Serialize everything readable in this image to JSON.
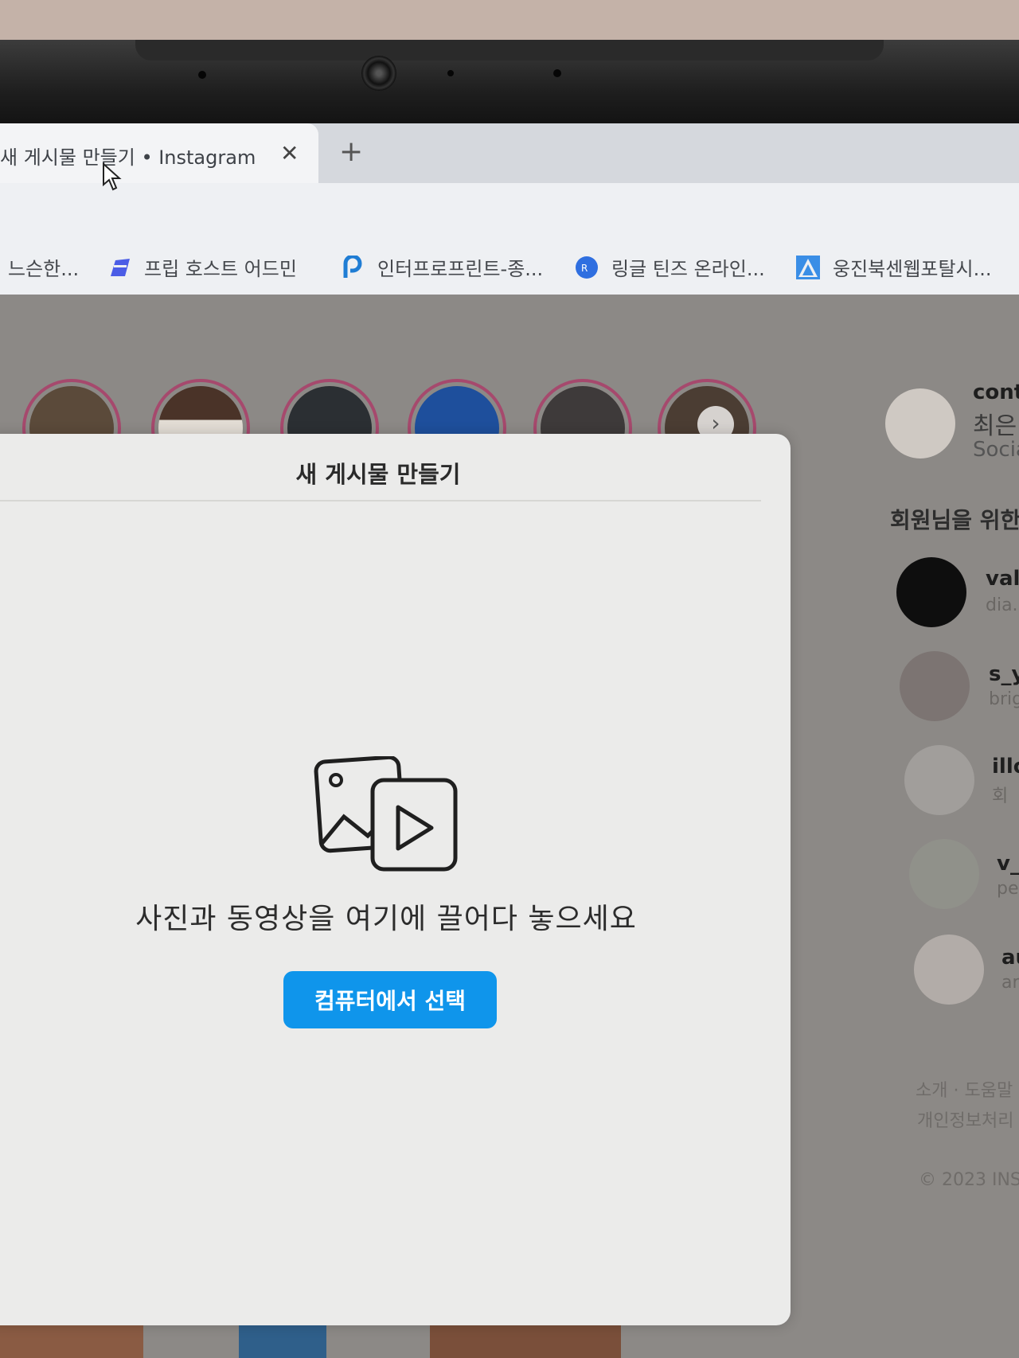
{
  "browser": {
    "tab_title": "새 게시물 만들기 • Instagram",
    "tab_close": "✕",
    "new_tab": "+",
    "bookmarks": [
      {
        "label": "느슨한...",
        "icon": "bookmark-icon"
      },
      {
        "label": "프립 호스트 어드민",
        "icon": "frip-icon"
      },
      {
        "label": "인터프로프린트-종...",
        "icon": "p-logo-icon"
      },
      {
        "label": "링글 틴즈 온라인...",
        "icon": "ringle-icon"
      },
      {
        "label": "웅진북센웹포탈시...",
        "icon": "a-logo-icon"
      }
    ]
  },
  "stories": {
    "next_label": "›"
  },
  "modal": {
    "title": "새 게시물 만들기",
    "drop_text": "사진과 동영상을 여기에 끌어다 놓으세요",
    "select_button": "컴퓨터에서 선택",
    "icon": "photo-video-icon",
    "accent": "#0f95eb"
  },
  "sidebar": {
    "profile": {
      "username": "cont",
      "name": "최은",
      "sub": "Socia"
    },
    "suggested_heading": "회원님을 위한",
    "suggestions": [
      {
        "name": "valu",
        "sub": "dia."
      },
      {
        "name": "s_y",
        "sub": "brig"
      },
      {
        "name": "illo",
        "sub": "회"
      },
      {
        "name": "v_",
        "sub": "pe"
      },
      {
        "name": "au",
        "sub": "ar"
      }
    ],
    "footer_line1": "소개 · 도움말",
    "footer_line2": "개인정보처리",
    "copyright": "© 2023 INST"
  }
}
